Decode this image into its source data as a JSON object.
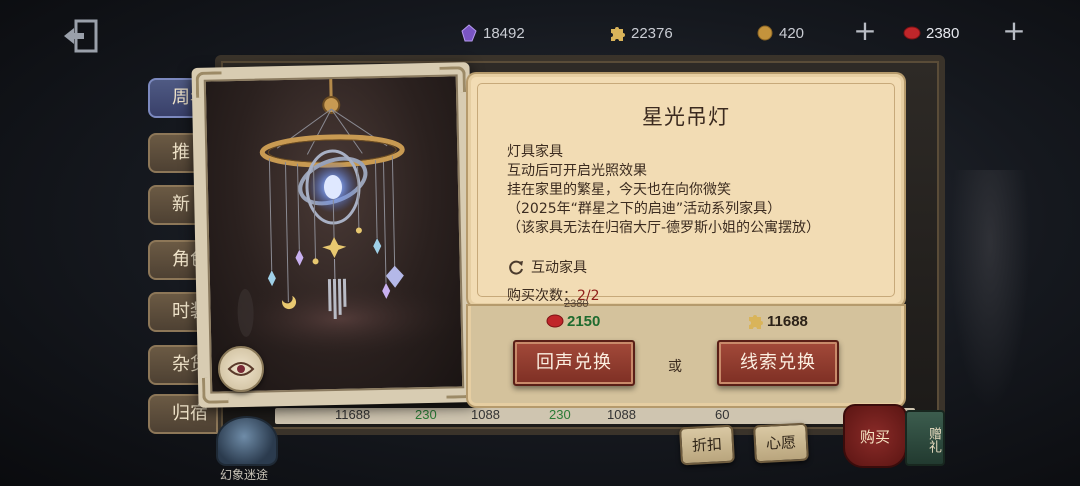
{
  "currencies": {
    "fragments": "18492",
    "clues": "22376",
    "sticks": "420",
    "echoes": "2380"
  },
  "categories": [
    "周年",
    "推",
    "新",
    "角色",
    "时装",
    "杂货",
    "归宿"
  ],
  "item": {
    "title": "星光吊灯",
    "description": [
      "灯具家具",
      "互动后可开启光照效果",
      "挂在家里的繁星，今天也在向你微笑",
      "（2025年“群星之下的启迪”活动系列家具）",
      "（该家具无法在归宿大厅-德罗斯小姐的公寓摆放）"
    ],
    "tag": "互动家具",
    "purchase_limit_label": "购买次数：",
    "purchase_limit_value": "2/2"
  },
  "pricing": {
    "echo_original": "2380",
    "echo_price": "2150",
    "clue_price": "11688",
    "echo_button": "回声兑换",
    "or_label": "或",
    "clue_button": "线索兑换"
  },
  "shop_strip": [
    "11688",
    "230",
    "1088",
    "230",
    "1088",
    "60"
  ],
  "bottom_buttons": {
    "discount": "折扣",
    "wish": "心愿",
    "buy": "购买",
    "gift": "赠礼"
  },
  "globe_label": "幻象迷途",
  "colors": {
    "panel_parchment": "#f2dcb4",
    "button_red": "#8e3a2d",
    "echo_green": "#1f6b2f",
    "active_tab": "#4f5a83"
  }
}
